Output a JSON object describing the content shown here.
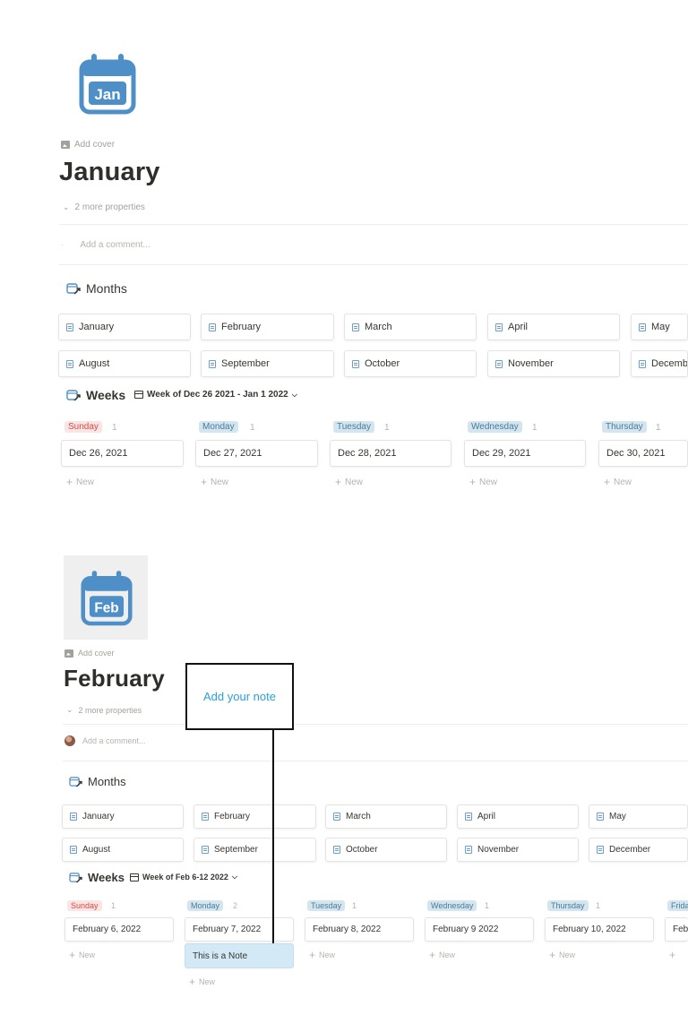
{
  "pages": [
    {
      "icon_label": "Jan",
      "add_cover": "Add cover",
      "title": "January",
      "more_properties": "2 more properties",
      "comment_placeholder": "Add a comment...",
      "months_header": "Months",
      "months_row1": [
        "January",
        "February",
        "March",
        "April",
        "May"
      ],
      "months_row2": [
        "August",
        "September",
        "October",
        "November",
        "Decembe"
      ],
      "weeks_header": "Weeks",
      "week_selector": "Week of Dec 26 2021 - Jan 1 2022",
      "days": [
        {
          "name": "Sunday",
          "count": "1",
          "date": "Dec 26, 2021"
        },
        {
          "name": "Monday",
          "count": "1",
          "date": "Dec 27, 2021"
        },
        {
          "name": "Tuesday",
          "count": "1",
          "date": "Dec 28, 2021"
        },
        {
          "name": "Wednesday",
          "count": "1",
          "date": "Dec 29, 2021"
        },
        {
          "name": "Thursday",
          "count": "1",
          "date": "Dec 30, 2021"
        }
      ],
      "new_label": "New"
    },
    {
      "icon_label": "Feb",
      "add_cover": "Add cover",
      "title": "February",
      "more_properties": "2 more properties",
      "comment_placeholder": "Add a comment...",
      "months_header": "Months",
      "months_row1": [
        "January",
        "February",
        "March",
        "April",
        "May"
      ],
      "months_row2": [
        "August",
        "September",
        "October",
        "November",
        "December"
      ],
      "weeks_header": "Weeks",
      "week_selector": "Week of Feb 6-12 2022",
      "days": [
        {
          "name": "Sunday",
          "count": "1",
          "date": "February 6, 2022"
        },
        {
          "name": "Monday",
          "count": "2",
          "date": "February 7, 2022"
        },
        {
          "name": "Tuesday",
          "count": "1",
          "date": "February 8, 2022"
        },
        {
          "name": "Wednesday",
          "count": "1",
          "date": "February 9 2022"
        },
        {
          "name": "Thursday",
          "count": "1",
          "date": "February 10, 2022"
        },
        {
          "name": "Frida",
          "count": "",
          "date": "Febr"
        }
      ],
      "note_card": "This is a Note",
      "new_label": "New"
    }
  ],
  "annotation": {
    "note_text": "Add your note"
  },
  "colors": {
    "icon_blue": "#4f8fc7",
    "sunday_bg": "#fbe4e4",
    "sunday_fg": "#d44c47",
    "weekday_bg": "#d3e5ef",
    "weekday_fg": "#4a7a99",
    "note_text": "#2a9fd8"
  }
}
